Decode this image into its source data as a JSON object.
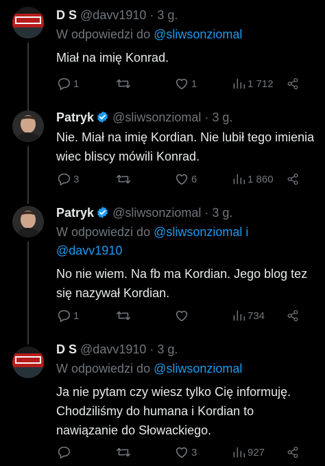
{
  "reply_prefix": "W odpowiedzi do",
  "tweets": [
    {
      "name": "D S",
      "handle": "@davv1910",
      "dot": "·",
      "time": "3 g.",
      "verified": false,
      "reply_to": [
        "@sliwsonziomal"
      ],
      "reply_joiner": "",
      "text": "Miał na imię Konrad.",
      "replies": "1",
      "retweets": "",
      "likes": "1",
      "views": "1 712"
    },
    {
      "name": "Patryk",
      "handle": "@sliwsonziomal",
      "dot": "·",
      "time": "3 g.",
      "verified": true,
      "reply_to": [],
      "text": "Nie. Miał na imię Kordian. Nie lubił tego imienia wiec bliscy mówili Konrad.",
      "replies": "3",
      "retweets": "",
      "likes": "6",
      "views": "1 860"
    },
    {
      "name": "Patryk",
      "handle": "@sliwsonziomal",
      "dot": "·",
      "time": "3 g.",
      "verified": true,
      "reply_to": [
        "@sliwsonziomal",
        "@davv1910"
      ],
      "reply_joiner": "i",
      "text": "No nie wiem. Na fb ma Kordian. Jego blog tez się nazywał Kordian.",
      "replies": "1",
      "retweets": "",
      "likes": "",
      "views": "734"
    },
    {
      "name": "D S",
      "handle": "@davv1910",
      "dot": "·",
      "time": "3 g.",
      "verified": false,
      "reply_to": [
        "@sliwsonziomal"
      ],
      "text": "Ja nie pytam czy wiesz tylko Cię informuję. Chodziliśmy do humana i Kordian to nawiązanie do Słowackiego.",
      "replies": "",
      "retweets": "",
      "likes": "3",
      "views": "927"
    }
  ],
  "colors": {
    "background": "#000000",
    "text": "#e7e9ea",
    "muted": "#71767b",
    "link": "#1d9bf0",
    "verified": "#1d9bf0"
  }
}
